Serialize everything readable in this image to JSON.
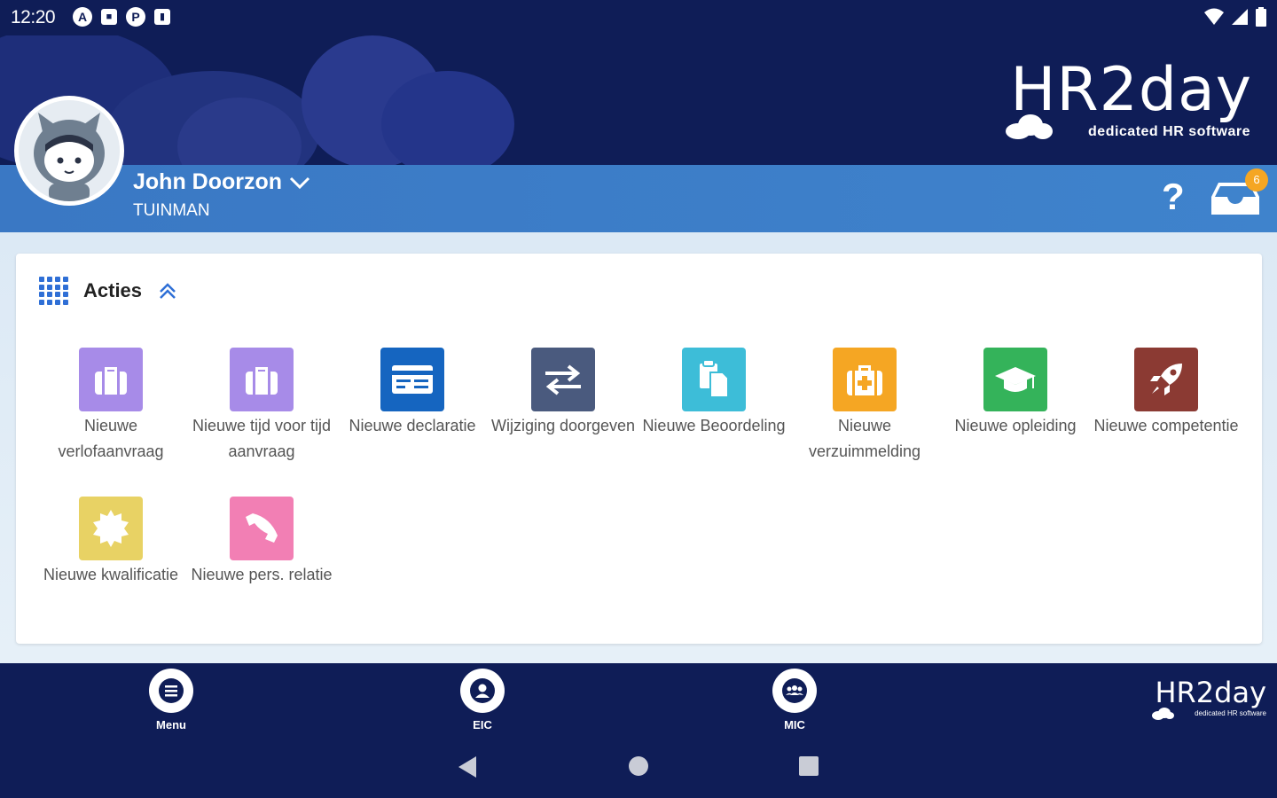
{
  "status_bar": {
    "time": "12:20",
    "notification_icons": [
      "A",
      "■",
      "P",
      "▮"
    ]
  },
  "brand": {
    "name": "HR2day",
    "tagline": "dedicated HR software"
  },
  "user": {
    "name": "John Doorzon",
    "role": "TUINMAN",
    "inbox_count": "6"
  },
  "help": {
    "label": "?"
  },
  "section": {
    "title": "Acties"
  },
  "actions": [
    {
      "label": "Nieuwe verlofaanvraag",
      "icon": "briefcase-icon",
      "color": "#a78be8"
    },
    {
      "label": "Nieuwe tijd voor tijd aanvraag",
      "icon": "briefcase-icon",
      "color": "#a78be8"
    },
    {
      "label": "Nieuwe declaratie",
      "icon": "receipt-icon",
      "color": "#1565c0"
    },
    {
      "label": "Wijziging doorgeven",
      "icon": "swap-arrows-icon",
      "color": "#4a5a7e"
    },
    {
      "label": "Nieuwe Beoordeling",
      "icon": "clipboard-copy-icon",
      "color": "#3dbdd8"
    },
    {
      "label": "Nieuwe verzuimmelding",
      "icon": "medical-kit-icon",
      "color": "#f5a623"
    },
    {
      "label": "Nieuwe opleiding",
      "icon": "graduation-cap-icon",
      "color": "#34b35a"
    },
    {
      "label": "Nieuwe competentie",
      "icon": "rocket-icon",
      "color": "#8b3a33"
    },
    {
      "label": "Nieuwe kwalificatie",
      "icon": "badge-seal-icon",
      "color": "#e8d264"
    },
    {
      "label": "Nieuwe pers. relatie",
      "icon": "phone-icon",
      "color": "#f27fb4"
    }
  ],
  "bottom_nav": [
    {
      "label": "Menu",
      "icon": "menu-icon"
    },
    {
      "label": "EIC",
      "icon": "person-icon"
    },
    {
      "label": "MIC",
      "icon": "group-icon"
    }
  ],
  "mini_brand": {
    "name": "HR2day",
    "tagline": "dedicated HR software"
  }
}
